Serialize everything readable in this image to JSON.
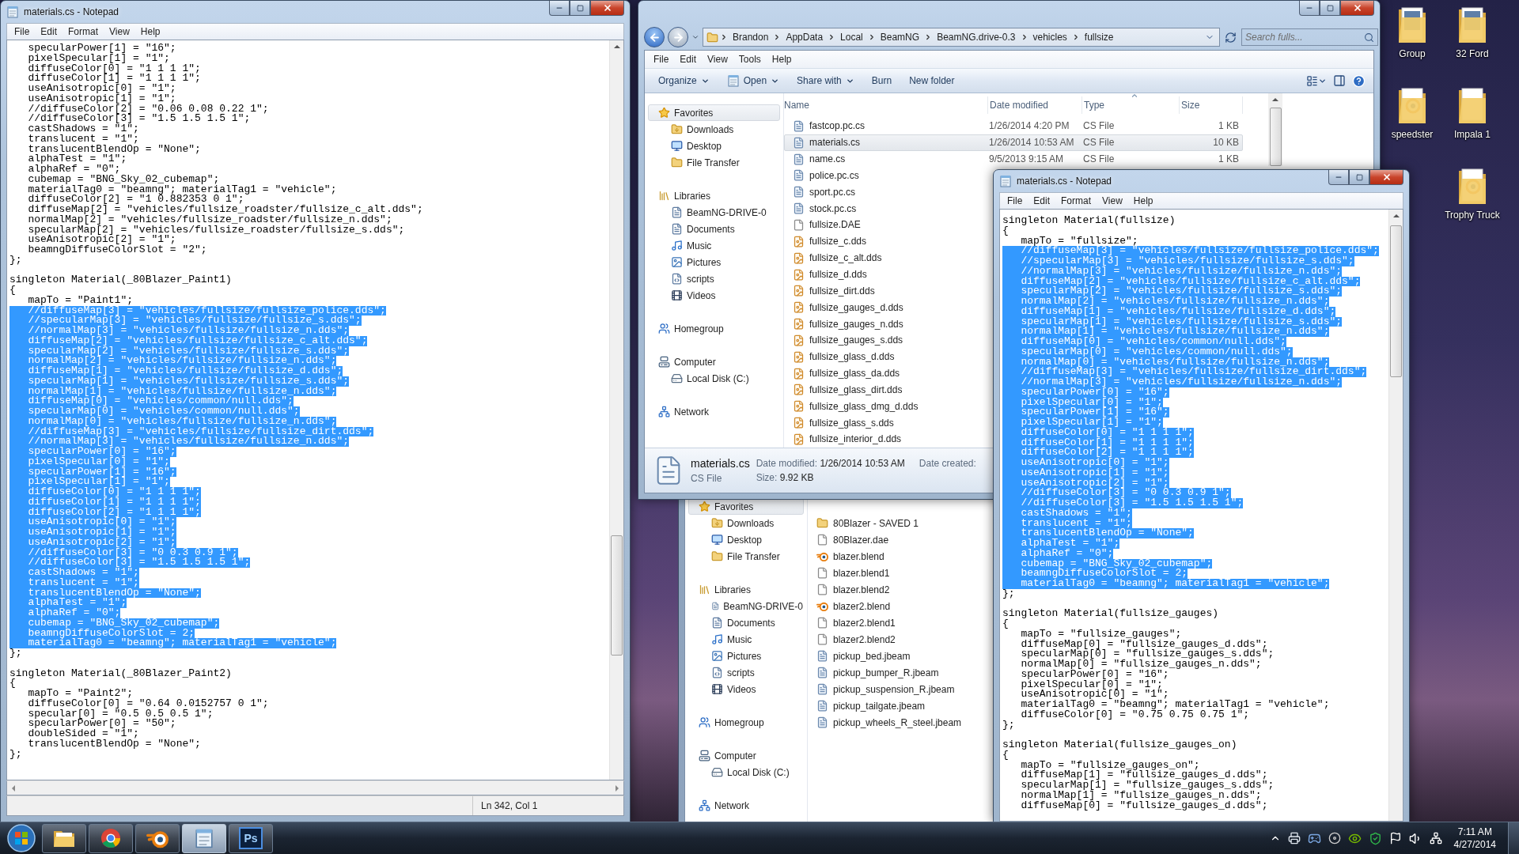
{
  "left_notepad": {
    "title": "materials.cs - Notepad",
    "menu": [
      "File",
      "Edit",
      "Format",
      "View",
      "Help"
    ],
    "blocks": [
      {
        "lines": [
          {
            "text": "   specularPower[1] = \"16\";",
            "selected": false
          },
          {
            "text": "   pixelSpecular[1] = \"1\";",
            "selected": false
          },
          {
            "text": "   diffuseColor[0] = \"1 1 1 1\";",
            "selected": false
          },
          {
            "text": "   diffuseColor[1] = \"1 1 1 1\";",
            "selected": false
          },
          {
            "text": "   useAnisotropic[0] = \"1\";",
            "selected": false
          },
          {
            "text": "   useAnisotropic[1] = \"1\";",
            "selected": false
          },
          {
            "text": "   //diffuseColor[2] = \"0.06 0.08 0.22 1\";",
            "selected": false
          },
          {
            "text": "   //diffuseColor[3] = \"1.5 1.5 1.5 1\";",
            "selected": false
          },
          {
            "text": "   castShadows = \"1\";",
            "selected": false
          },
          {
            "text": "   translucent = \"1\";",
            "selected": false
          },
          {
            "text": "   translucentBlendOp = \"None\";",
            "selected": false
          },
          {
            "text": "   alphaTest = \"1\";",
            "selected": false
          },
          {
            "text": "   alphaRef = \"0\";",
            "selected": false
          },
          {
            "text": "   cubemap = \"BNG_Sky_02_cubemap\";",
            "selected": false
          },
          {
            "text": "   materialTag0 = \"beamng\"; materialTag1 = \"vehicle\";",
            "selected": false
          },
          {
            "text": "   diffuseColor[2] = \"1 0.882353 0 1\";",
            "selected": false
          },
          {
            "text": "   diffuseMap[2] = \"vehicles/fullsize_roadster/fullsize_c_alt.dds\";",
            "selected": false
          },
          {
            "text": "   normalMap[2] = \"vehicles/fullsize_roadster/fullsize_n.dds\";",
            "selected": false
          },
          {
            "text": "   specularMap[2] = \"vehicles/fullsize_roadster/fullsize_s.dds\";",
            "selected": false
          },
          {
            "text": "   useAnisotropic[2] = \"1\";",
            "selected": false
          },
          {
            "text": "   beamngDiffuseColorSlot = \"2\";",
            "selected": false
          },
          {
            "text": "};",
            "selected": false
          }
        ]
      },
      {
        "lines": [
          {
            "text": "singleton Material(_80Blazer_Paint1)",
            "selected": false
          },
          {
            "text": "{",
            "selected": false
          },
          {
            "text": "   mapTo = \"Paint1\";",
            "selected": false
          },
          {
            "text": "   //diffuseMap[3] = \"vehicles/fullsize/fullsize_police.dds\";",
            "selected": true
          },
          {
            "text": "   //specularMap[3] = \"vehicles/fullsize/fullsize_s.dds\";",
            "selected": true
          },
          {
            "text": "   //normalMap[3] = \"vehicles/fullsize/fullsize_n.dds\";",
            "selected": true
          },
          {
            "text": "   diffuseMap[2] = \"vehicles/fullsize/fullsize_c_alt.dds\";",
            "selected": true
          },
          {
            "text": "   specularMap[2] = \"vehicles/fullsize/fullsize_s.dds\";",
            "selected": true
          },
          {
            "text": "   normalMap[2] = \"vehicles/fullsize/fullsize_n.dds\";",
            "selected": true
          },
          {
            "text": "   diffuseMap[1] = \"vehicles/fullsize/fullsize_d.dds\";",
            "selected": true
          },
          {
            "text": "   specularMap[1] = \"vehicles/fullsize/fullsize_s.dds\";",
            "selected": true
          },
          {
            "text": "   normalMap[1] = \"vehicles/fullsize/fullsize_n.dds\";",
            "selected": true
          },
          {
            "text": "   diffuseMap[0] = \"vehicles/common/null.dds\";",
            "selected": true
          },
          {
            "text": "   specularMap[0] = \"vehicles/common/null.dds\";",
            "selected": true
          },
          {
            "text": "   normalMap[0] = \"vehicles/fullsize/fullsize_n.dds\";",
            "selected": true
          },
          {
            "text": "   //diffuseMap[3] = \"vehicles/fullsize/fullsize_dirt.dds\";",
            "selected": true
          },
          {
            "text": "   //normalMap[3] = \"vehicles/fullsize/fullsize_n.dds\";",
            "selected": true
          },
          {
            "text": "   specularPower[0] = \"16\";",
            "selected": true
          },
          {
            "text": "   pixelSpecular[0] = \"1\";",
            "selected": true
          },
          {
            "text": "   specularPower[1] = \"16\";",
            "selected": true
          },
          {
            "text": "   pixelSpecular[1] = \"1\";",
            "selected": true
          },
          {
            "text": "   diffuseColor[0] = \"1 1 1 1\";",
            "selected": true
          },
          {
            "text": "   diffuseColor[1] = \"1 1 1 1\";",
            "selected": true
          },
          {
            "text": "   diffuseColor[2] = \"1 1 1 1\";",
            "selected": true
          },
          {
            "text": "   useAnisotropic[0] = \"1\";",
            "selected": true
          },
          {
            "text": "   useAnisotropic[1] = \"1\";",
            "selected": true
          },
          {
            "text": "   useAnisotropic[2] = \"1\";",
            "selected": true
          },
          {
            "text": "   //diffuseColor[3] = \"0 0.3 0.9 1\";",
            "selected": true
          },
          {
            "text": "   //diffuseColor[3] = \"1.5 1.5 1.5 1\";",
            "selected": true
          },
          {
            "text": "   castShadows = \"1\";",
            "selected": true
          },
          {
            "text": "   translucent = \"1\";",
            "selected": true
          },
          {
            "text": "   translucentBlendOp = \"None\";",
            "selected": true
          },
          {
            "text": "   alphaTest = \"1\";",
            "selected": true
          },
          {
            "text": "   alphaRef = \"0\";",
            "selected": true
          },
          {
            "text": "   cubemap = \"BNG_Sky_02_cubemap\";",
            "selected": true
          },
          {
            "text": "   beamngDiffuseColorSlot = 2;",
            "selected": true
          },
          {
            "text": "   materialTag0 = \"beamng\"; materialTag1 = \"vehicle\";",
            "selected": true
          },
          {
            "text": "};",
            "selected": false
          }
        ]
      },
      {
        "lines": [
          {
            "text": "singleton Material(_80Blazer_Paint2)",
            "selected": false
          },
          {
            "text": "{",
            "selected": false
          },
          {
            "text": "   mapTo = \"Paint2\";",
            "selected": false
          },
          {
            "text": "   diffuseColor[0] = \"0.64 0.0152757 0 1\";",
            "selected": false
          },
          {
            "text": "   specular[0] = \"0.5 0.5 0.5 1\";",
            "selected": false
          },
          {
            "text": "   specularPower[0] = \"50\";",
            "selected": false
          },
          {
            "text": "   doubleSided = \"1\";",
            "selected": false
          },
          {
            "text": "   translucentBlendOp = \"None\";",
            "selected": false
          },
          {
            "text": "};",
            "selected": false
          }
        ]
      }
    ],
    "status": "Ln 342, Col 1"
  },
  "explorer": {
    "path": [
      "Brandon",
      "AppData",
      "Local",
      "BeamNG",
      "BeamNG.drive-0.3",
      "vehicles",
      "fullsize"
    ],
    "search": {
      "placeholder": "Search fulls..."
    },
    "menu": [
      "File",
      "Edit",
      "View",
      "Tools",
      "Help"
    ],
    "toolbar": [
      {
        "label": "Organize",
        "dropdown": true
      },
      {
        "label": "Open",
        "dropdown": true
      },
      {
        "label": "Share with",
        "dropdown": true
      },
      {
        "label": "Burn",
        "dropdown": false
      },
      {
        "label": "New folder",
        "dropdown": false
      }
    ],
    "nav": [
      {
        "label": "Favorites",
        "selected": true,
        "children": [
          {
            "label": "Downloads",
            "selected": false
          },
          {
            "label": "Desktop",
            "selected": false
          },
          {
            "label": "File Transfer",
            "selected": false
          }
        ]
      },
      {
        "label": "Libraries",
        "selected": false,
        "children": [
          {
            "label": "BeamNG-DRIVE-0",
            "selected": false
          },
          {
            "label": "Documents",
            "selected": false
          },
          {
            "label": "Music",
            "selected": false
          },
          {
            "label": "Pictures",
            "selected": false
          },
          {
            "label": "scripts",
            "selected": false
          },
          {
            "label": "Videos",
            "selected": false
          }
        ]
      },
      {
        "label": "Homegroup",
        "selected": false
      },
      {
        "label": "Computer",
        "selected": false,
        "children": [
          {
            "label": "Local Disk (C:)",
            "selected": false
          }
        ]
      },
      {
        "label": "Network",
        "selected": false
      }
    ],
    "columns": [
      {
        "label": "Name",
        "sorted": false
      },
      {
        "label": "Date modified",
        "sorted": false
      },
      {
        "label": "Type",
        "sorted": true
      },
      {
        "label": "Size",
        "sorted": false
      }
    ],
    "rows": [
      {
        "name": "fastcop.pc.cs",
        "kind": "script",
        "date": "1/26/2014 4:20 PM",
        "type": "CS File",
        "size": "1 KB",
        "selected": false
      },
      {
        "name": "materials.cs",
        "kind": "script",
        "date": "1/26/2014 10:53 AM",
        "type": "CS File",
        "size": "10 KB",
        "selected": true
      },
      {
        "name": "name.cs",
        "kind": "script",
        "date": "9/5/2013 9:15 AM",
        "type": "CS File",
        "size": "1 KB",
        "selected": false
      },
      {
        "name": "police.pc.cs",
        "kind": "script",
        "selected": false
      },
      {
        "name": "sport.pc.cs",
        "kind": "script",
        "selected": false
      },
      {
        "name": "stock.pc.cs",
        "kind": "script",
        "selected": false
      },
      {
        "name": "fullsize.DAE",
        "kind": "blank",
        "selected": false
      },
      {
        "name": "fullsize_c.dds",
        "kind": "texture",
        "selected": false
      },
      {
        "name": "fullsize_c_alt.dds",
        "kind": "texture",
        "selected": false
      },
      {
        "name": "fullsize_d.dds",
        "kind": "texture",
        "selected": false
      },
      {
        "name": "fullsize_dirt.dds",
        "kind": "texture",
        "selected": false
      },
      {
        "name": "fullsize_gauges_d.dds",
        "kind": "texture",
        "selected": false
      },
      {
        "name": "fullsize_gauges_n.dds",
        "kind": "texture",
        "selected": false
      },
      {
        "name": "fullsize_gauges_s.dds",
        "kind": "texture",
        "selected": false
      },
      {
        "name": "fullsize_glass_d.dds",
        "kind": "texture",
        "selected": false
      },
      {
        "name": "fullsize_glass_da.dds",
        "kind": "texture",
        "selected": false
      },
      {
        "name": "fullsize_glass_dirt.dds",
        "kind": "texture",
        "selected": false
      },
      {
        "name": "fullsize_glass_dmg_d.dds",
        "kind": "texture",
        "selected": false
      },
      {
        "name": "fullsize_glass_s.dds",
        "kind": "texture",
        "selected": false
      },
      {
        "name": "fullsize_interior_d.dds",
        "kind": "texture",
        "selected": false
      }
    ],
    "details": {
      "name": "materials.cs",
      "type": "CS File",
      "fields": [
        {
          "label": "Date modified:",
          "value": "1/26/2014 10:53 AM"
        },
        {
          "label": "Size:",
          "value": "9.92 KB"
        },
        {
          "label": "Date created:"
        }
      ]
    }
  },
  "explorer_back": {
    "nav": [
      {
        "label": "Favorites",
        "selected": true,
        "children": [
          {
            "label": "Downloads",
            "selected": false
          },
          {
            "label": "Desktop",
            "selected": false
          },
          {
            "label": "File Transfer",
            "selected": false
          }
        ]
      },
      {
        "label": "Libraries",
        "selected": false,
        "children": [
          {
            "label": "BeamNG-DRIVE-0",
            "selected": false
          },
          {
            "label": "Documents",
            "selected": false
          },
          {
            "label": "Music",
            "selected": false
          },
          {
            "label": "Pictures",
            "selected": false
          },
          {
            "label": "scripts",
            "selected": false
          },
          {
            "label": "Videos",
            "selected": false
          }
        ]
      },
      {
        "label": "Homegroup",
        "selected": false
      },
      {
        "label": "Computer",
        "selected": false,
        "children": [
          {
            "label": "Local Disk (C:)",
            "selected": false
          }
        ]
      },
      {
        "label": "Network",
        "selected": false
      }
    ],
    "rows": [
      {
        "name": "80Blazer - SAVED 1",
        "kind": "folder",
        "selected": false
      },
      {
        "name": "80Blazer.dae",
        "kind": "blank",
        "selected": false
      },
      {
        "name": "blazer.blend",
        "kind": "blender",
        "selected": false
      },
      {
        "name": "blazer.blend1",
        "kind": "blank",
        "selected": false
      },
      {
        "name": "blazer.blend2",
        "kind": "blank",
        "selected": false
      },
      {
        "name": "blazer2.blend",
        "kind": "blender",
        "selected": false
      },
      {
        "name": "blazer2.blend1",
        "kind": "blank",
        "selected": false
      },
      {
        "name": "blazer2.blend2",
        "kind": "blank",
        "selected": false
      },
      {
        "name": "pickup_bed.jbeam",
        "kind": "script",
        "selected": false
      },
      {
        "name": "pickup_bumper_R.jbeam",
        "kind": "script",
        "selected": false
      },
      {
        "name": "pickup_suspension_R.jbeam",
        "kind": "script",
        "selected": false
      },
      {
        "name": "pickup_tailgate.jbeam",
        "kind": "script",
        "selected": false
      },
      {
        "name": "pickup_wheels_R_steel.jbeam",
        "kind": "script",
        "selected": false
      }
    ]
  },
  "right_notepad": {
    "title": "materials.cs - Notepad",
    "menu": [
      "File",
      "Edit",
      "Format",
      "View",
      "Help"
    ],
    "blocks": [
      {
        "lines": [
          {
            "text": "singleton Material(fullsize)",
            "selected": false
          },
          {
            "text": "{",
            "selected": false
          },
          {
            "text": "   mapTo = \"fullsize\";",
            "selected": false
          },
          {
            "text": "   //diffuseMap[3] = \"vehicles/fullsize/fullsize_police.dds\";",
            "selected": true
          },
          {
            "text": "   //specularMap[3] = \"vehicles/fullsize/fullsize_s.dds\";",
            "selected": true
          },
          {
            "text": "   //normalMap[3] = \"vehicles/fullsize/fullsize_n.dds\";",
            "selected": true
          },
          {
            "text": "   diffuseMap[2] = \"vehicles/fullsize/fullsize_c_alt.dds\";",
            "selected": true
          },
          {
            "text": "   specularMap[2] = \"vehicles/fullsize/fullsize_s.dds\";",
            "selected": true
          },
          {
            "text": "   normalMap[2] = \"vehicles/fullsize/fullsize_n.dds\";",
            "selected": true
          },
          {
            "text": "   diffuseMap[1] = \"vehicles/fullsize/fullsize_d.dds\";",
            "selected": true
          },
          {
            "text": "   specularMap[1] = \"vehicles/fullsize/fullsize_s.dds\";",
            "selected": true
          },
          {
            "text": "   normalMap[1] = \"vehicles/fullsize/fullsize_n.dds\";",
            "selected": true
          },
          {
            "text": "   diffuseMap[0] = \"vehicles/common/null.dds\";",
            "selected": true
          },
          {
            "text": "   specularMap[0] = \"vehicles/common/null.dds\";",
            "selected": true
          },
          {
            "text": "   normalMap[0] = \"vehicles/fullsize/fullsize_n.dds\";",
            "selected": true
          },
          {
            "text": "   //diffuseMap[3] = \"vehicles/fullsize/fullsize_dirt.dds\";",
            "selected": true
          },
          {
            "text": "   //normalMap[3] = \"vehicles/fullsize/fullsize_n.dds\";",
            "selected": true
          },
          {
            "text": "   specularPower[0] = \"16\";",
            "selected": true
          },
          {
            "text": "   pixelSpecular[0] = \"1\";",
            "selected": true
          },
          {
            "text": "   specularPower[1] = \"16\";",
            "selected": true
          },
          {
            "text": "   pixelSpecular[1] = \"1\";",
            "selected": true
          },
          {
            "text": "   diffuseColor[0] = \"1 1 1 1\";",
            "selected": true
          },
          {
            "text": "   diffuseColor[1] = \"1 1 1 1\";",
            "selected": true
          },
          {
            "text": "   diffuseColor[2] = \"1 1 1 1\";",
            "selected": true
          },
          {
            "text": "   useAnisotropic[0] = \"1\";",
            "selected": true
          },
          {
            "text": "   useAnisotropic[1] = \"1\";",
            "selected": true
          },
          {
            "text": "   useAnisotropic[2] = \"1\";",
            "selected": true
          },
          {
            "text": "   //diffuseColor[3] = \"0 0.3 0.9 1\";",
            "selected": true
          },
          {
            "text": "   //diffuseColor[3] = \"1.5 1.5 1.5 1\";",
            "selected": true
          },
          {
            "text": "   castShadows = \"1\";",
            "selected": true
          },
          {
            "text": "   translucent = \"1\";",
            "selected": true
          },
          {
            "text": "   translucentBlendOp = \"None\";",
            "selected": true
          },
          {
            "text": "   alphaTest = \"1\";",
            "selected": true
          },
          {
            "text": "   alphaRef = \"0\";",
            "selected": true
          },
          {
            "text": "   cubemap = \"BNG_Sky_02_cubemap\";",
            "selected": true
          },
          {
            "text": "   beamngDiffuseColorSlot = 2;",
            "selected": true
          },
          {
            "text": "   materialTag0 = \"beamng\"; materialTag1 = \"vehicle\";",
            "selected": true
          },
          {
            "text": "};",
            "selected": false
          }
        ]
      },
      {
        "lines": [
          {
            "text": "singleton Material(fullsize_gauges)",
            "selected": false
          },
          {
            "text": "{",
            "selected": false
          },
          {
            "text": "   mapTo = \"fullsize_gauges\";",
            "selected": false
          },
          {
            "text": "   diffuseMap[0] = \"fullsize_gauges_d.dds\";",
            "selected": false
          },
          {
            "text": "   specularMap[0] = \"fullsize_gauges_s.dds\";",
            "selected": false
          },
          {
            "text": "   normalMap[0] = \"fullsize_gauges_n.dds\";",
            "selected": false
          },
          {
            "text": "   specularPower[0] = \"16\";",
            "selected": false
          },
          {
            "text": "   pixelSpecular[0] = \"1\";",
            "selected": false
          },
          {
            "text": "   useAnisotropic[0] = \"1\";",
            "selected": false
          },
          {
            "text": "   materialTag0 = \"beamng\"; materialTag1 = \"vehicle\";",
            "selected": false
          },
          {
            "text": "   diffuseColor[0] = \"0.75 0.75 0.75 1\";",
            "selected": false
          },
          {
            "text": "};",
            "selected": false
          }
        ]
      },
      {
        "lines": [
          {
            "text": "singleton Material(fullsize_gauges_on)",
            "selected": false
          },
          {
            "text": "{",
            "selected": false
          },
          {
            "text": "   mapTo = \"fullsize_gauges_on\";",
            "selected": false
          },
          {
            "text": "   diffuseMap[1] = \"fullsize_gauges_d.dds\";",
            "selected": false
          },
          {
            "text": "   specularMap[1] = \"fullsize_gauges_s.dds\";",
            "selected": false
          },
          {
            "text": "   normalMap[1] = \"fullsize_gauges_n.dds\";",
            "selected": false
          },
          {
            "text": "   diffuseMap[0] = \"fullsize_gauges_d.dds\";",
            "selected": false
          }
        ]
      }
    ]
  },
  "desktop_icons": [
    {
      "label": "Group",
      "kind": "photo"
    },
    {
      "label": "32 Ford",
      "kind": "photo"
    },
    {
      "label": "speedster",
      "kind": "blend"
    },
    {
      "label": "Impala 1",
      "kind": "plain"
    },
    {
      "label": "Trophy Truck",
      "kind": "blend"
    }
  ],
  "taskbar": {
    "apps": [
      {
        "kind": "explorer",
        "selected": false
      },
      {
        "kind": "browser",
        "selected": false
      },
      {
        "kind": "blender",
        "selected": false
      },
      {
        "kind": "notepad",
        "selected": true
      },
      {
        "kind": "photoshop",
        "label": "Ps",
        "selected": false
      }
    ],
    "clock": {
      "time": "7:11 AM",
      "date": "4/27/2014"
    }
  }
}
